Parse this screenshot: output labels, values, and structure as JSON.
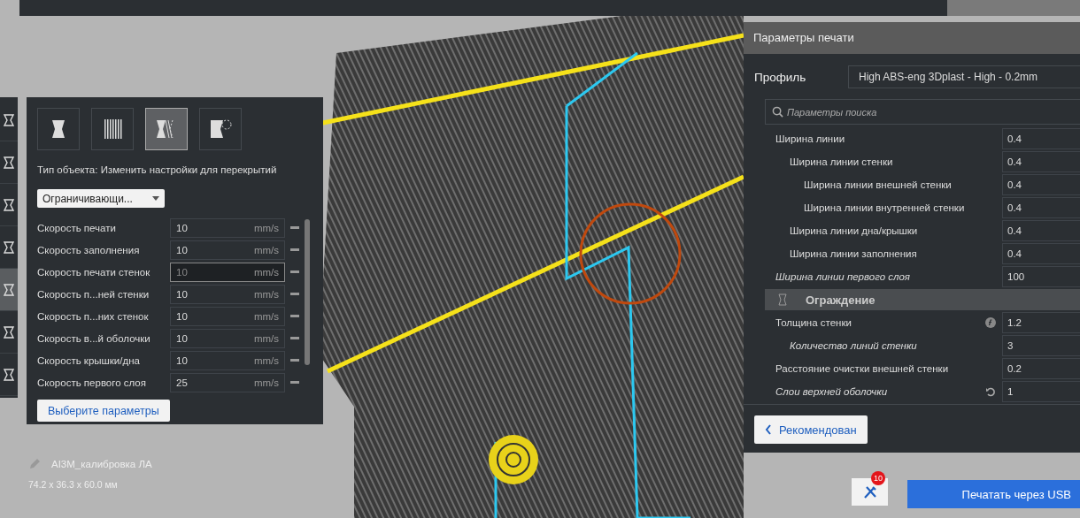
{
  "left_toolbar": {
    "tools": [
      {
        "selected": false
      },
      {
        "selected": false
      },
      {
        "selected": false
      },
      {
        "selected": false
      },
      {
        "selected": true
      },
      {
        "selected": false
      },
      {
        "selected": false
      }
    ]
  },
  "mesh_panel": {
    "types": [
      {
        "selected": false
      },
      {
        "selected": false
      },
      {
        "selected": true
      },
      {
        "selected": false
      }
    ],
    "object_type_label": "Тип объекта: Изменить настройки для перекрытий",
    "dropdown": "Ограничивающи...",
    "settings": [
      {
        "label": "Скорость печати",
        "value": "10",
        "unit": "mm/s",
        "focused": false
      },
      {
        "label": "Скорость заполнения",
        "value": "10",
        "unit": "mm/s",
        "focused": false
      },
      {
        "label": "Скорость печати стенок",
        "value": "10",
        "unit": "mm/s",
        "focused": true
      },
      {
        "label": "Скорость п...ней стенки",
        "value": "10",
        "unit": "mm/s",
        "focused": false
      },
      {
        "label": "Скорость п...них стенок",
        "value": "10",
        "unit": "mm/s",
        "focused": false
      },
      {
        "label": "Скорость в...й оболочки",
        "value": "10",
        "unit": "mm/s",
        "focused": false
      },
      {
        "label": "Скорость крышки/дна",
        "value": "10",
        "unit": "mm/s",
        "focused": false
      },
      {
        "label": "Скорость первого слоя",
        "value": "25",
        "unit": "mm/s",
        "focused": false
      }
    ],
    "button": "Выберите параметры"
  },
  "object": {
    "name": "AI3M_калибровка ЛА",
    "dimensions": "74.2 x 36.3 x 60.0 мм"
  },
  "print_settings": {
    "title": "Параметры печати",
    "profile_label": "Профиль",
    "profile": "High ABS-eng 3Dplast - High - 0.2mm",
    "search": {
      "placeholder": "Параметры поиска"
    },
    "items": [
      {
        "kind": "setting",
        "label": "Ширина линии",
        "value": "0.4",
        "inherited": false,
        "children": [
          {
            "kind": "setting",
            "label": "Ширина линии стенки",
            "value": "0.4",
            "inherited": false,
            "children": [
              {
                "kind": "setting",
                "label": "Ширина линии внешней стенки",
                "value": "0.4",
                "inherited": false
              },
              {
                "kind": "setting",
                "label": "Ширина линии внутренней стенки",
                "value": "0.4",
                "inherited": false
              }
            ]
          },
          {
            "kind": "setting",
            "label": "Ширина линии дна/крышки",
            "value": "0.4",
            "inherited": false
          },
          {
            "kind": "setting",
            "label": "Ширина линии заполнения",
            "value": "0.4",
            "inherited": false
          }
        ]
      },
      {
        "kind": "setting",
        "label": "Ширина линии первого слоя",
        "value": "100",
        "inherited": true
      },
      {
        "kind": "category",
        "label": "Ограждение"
      },
      {
        "kind": "setting",
        "label": "Толщина стенки",
        "value": "1.2",
        "inherited": false,
        "formula": true,
        "children": [
          {
            "kind": "setting",
            "label": "Количество линий стенки",
            "value": "3",
            "inherited": true
          }
        ]
      },
      {
        "kind": "setting",
        "label": "Расстояние очистки внешней стенки",
        "value": "0.2",
        "inherited": false
      },
      {
        "kind": "setting",
        "label": "Слои верхней оболочки",
        "value": "1",
        "inherited": true,
        "modified": true
      }
    ],
    "back_button": "Рекомендован"
  },
  "tools_button": {
    "badge": "10"
  },
  "print_button": "Печатать через USB"
}
